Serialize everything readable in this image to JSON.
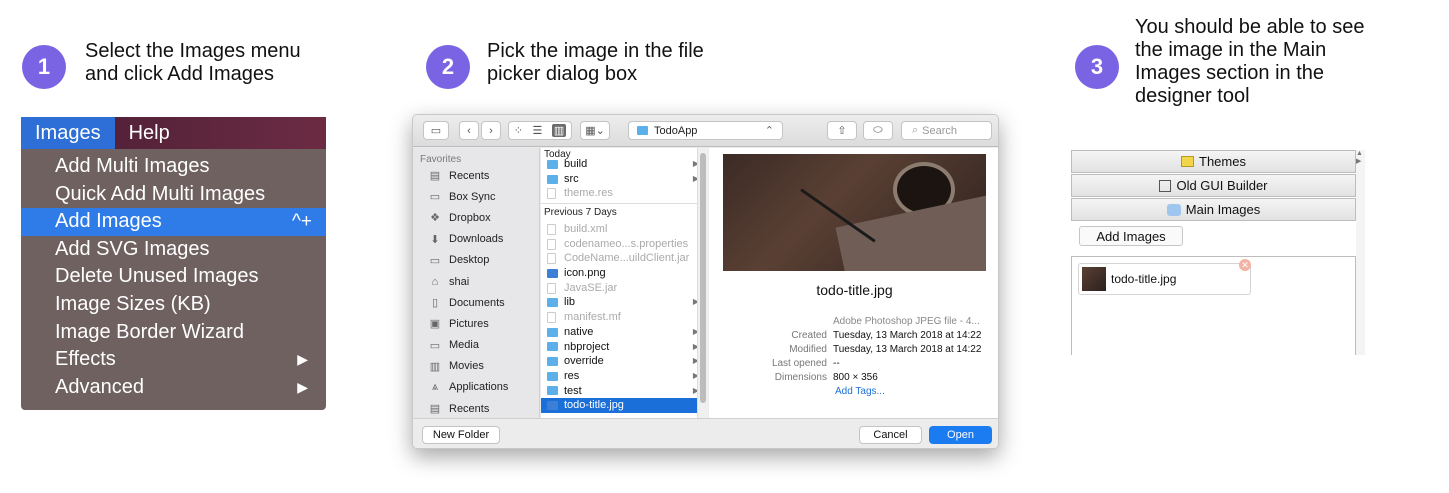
{
  "steps": [
    {
      "number": "1",
      "text": "Select the Images menu\nand click Add Images"
    },
    {
      "number": "2",
      "text": "Pick the image in the file\npicker dialog box"
    },
    {
      "number": "3",
      "text": "You should be able to see\nthe image in the Main\nImages section in the\ndesigner tool"
    }
  ],
  "colors": {
    "badge": "#7b64e3",
    "menu_bg": "#6e6160",
    "selection": "#2f7ce8",
    "open_button": "#1a7cf0"
  },
  "menu": {
    "bar": [
      "Images",
      "Help"
    ],
    "items": [
      {
        "label": "Add Multi Images",
        "shortcut": "",
        "submenu": false
      },
      {
        "label": "Quick Add Multi Images",
        "shortcut": "",
        "submenu": false
      },
      {
        "label": "Add Images",
        "shortcut": "^+",
        "submenu": false
      },
      {
        "label": "Add SVG Images",
        "shortcut": "",
        "submenu": false
      },
      {
        "label": "Delete Unused Images",
        "shortcut": "",
        "submenu": false
      },
      {
        "label": "Image Sizes (KB)",
        "shortcut": "",
        "submenu": false
      },
      {
        "label": "Image Border Wizard",
        "shortcut": "",
        "submenu": false
      },
      {
        "label": "Effects",
        "shortcut": "",
        "submenu": true
      },
      {
        "label": "Advanced",
        "shortcut": "",
        "submenu": true
      }
    ]
  },
  "dialog": {
    "location": "TodoApp",
    "search_placeholder": "Search",
    "sidebar_heading": "Favorites",
    "sidebar": [
      {
        "label": "Recents",
        "icon": "recents-icon"
      },
      {
        "label": "Box Sync",
        "icon": "box-icon"
      },
      {
        "label": "Dropbox",
        "icon": "dropbox-icon"
      },
      {
        "label": "Downloads",
        "icon": "downloads-icon"
      },
      {
        "label": "Desktop",
        "icon": "desktop-icon"
      },
      {
        "label": "shai",
        "icon": "home-icon"
      },
      {
        "label": "Documents",
        "icon": "documents-icon"
      },
      {
        "label": "Pictures",
        "icon": "pictures-icon"
      },
      {
        "label": "Media",
        "icon": "folder-icon"
      },
      {
        "label": "Movies",
        "icon": "movies-icon"
      },
      {
        "label": "Applications",
        "icon": "applications-icon"
      },
      {
        "label": "Recents",
        "icon": "recents-icon"
      }
    ],
    "today_heading": "Today",
    "today": [
      {
        "name": "build",
        "kind": "folder",
        "dim": false,
        "submenu": true
      },
      {
        "name": "src",
        "kind": "folder",
        "dim": false,
        "submenu": true
      },
      {
        "name": "theme.res",
        "kind": "file",
        "dim": true,
        "submenu": false
      }
    ],
    "prev_heading": "Previous 7 Days",
    "previous": [
      {
        "name": "build.xml",
        "kind": "file",
        "dim": true,
        "submenu": false
      },
      {
        "name": "codenameo...s.properties",
        "kind": "file",
        "dim": true,
        "submenu": false
      },
      {
        "name": "CodeName...uildClient.jar",
        "kind": "file",
        "dim": true,
        "submenu": false
      },
      {
        "name": "icon.png",
        "kind": "img",
        "dim": false,
        "submenu": false
      },
      {
        "name": "JavaSE.jar",
        "kind": "file",
        "dim": true,
        "submenu": false
      },
      {
        "name": "lib",
        "kind": "folder",
        "dim": false,
        "submenu": true
      },
      {
        "name": "manifest.mf",
        "kind": "file",
        "dim": true,
        "submenu": false
      },
      {
        "name": "native",
        "kind": "folder",
        "dim": false,
        "submenu": true
      },
      {
        "name": "nbproject",
        "kind": "folder",
        "dim": false,
        "submenu": true
      },
      {
        "name": "override",
        "kind": "folder",
        "dim": false,
        "submenu": true
      },
      {
        "name": "res",
        "kind": "folder",
        "dim": false,
        "submenu": true
      },
      {
        "name": "test",
        "kind": "folder",
        "dim": false,
        "submenu": true
      },
      {
        "name": "todo-title.jpg",
        "kind": "img",
        "dim": false,
        "submenu": false,
        "selected": true
      }
    ],
    "preview": {
      "filename": "todo-title.jpg",
      "kind": "Adobe Photoshop JPEG file - 4...",
      "created_label": "Created",
      "created": "Tuesday, 13 March 2018 at 14:22",
      "modified_label": "Modified",
      "modified": "Tuesday, 13 March 2018 at 14:22",
      "opened_label": "Last opened",
      "opened": "--",
      "dimensions_label": "Dimensions",
      "dimensions": "800 × 356",
      "add_tags": "Add Tags..."
    },
    "new_folder": "New Folder",
    "cancel": "Cancel",
    "open": "Open"
  },
  "designer": {
    "themes": "Themes",
    "old_gui": "Old GUI Builder",
    "main_images": "Main Images",
    "add_images": "Add Images",
    "image_name": "todo-title.jpg"
  }
}
